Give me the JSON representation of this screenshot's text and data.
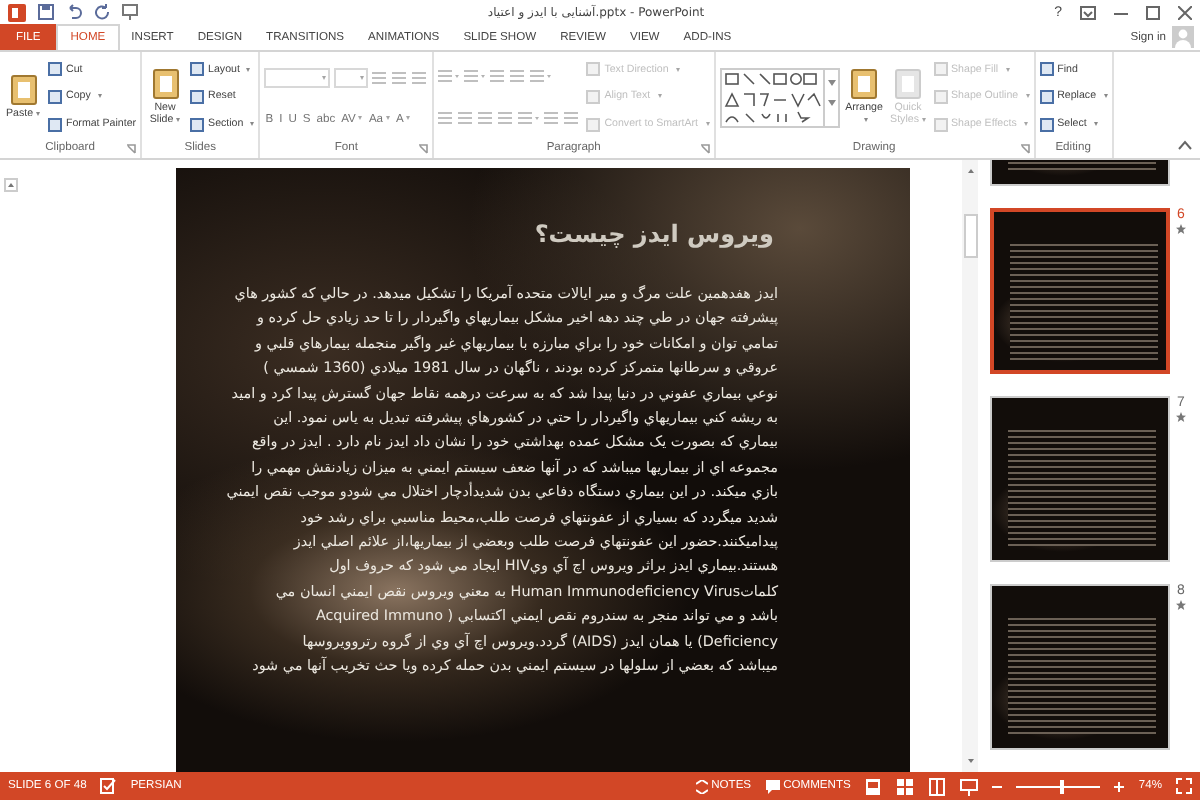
{
  "window": {
    "title": "آشنایی با ایدز و اعتیاد.pptx - PowerPoint",
    "help": "?",
    "sign_in": "Sign in"
  },
  "tabs": [
    {
      "label": "FILE",
      "kind": "file",
      "selected": false
    },
    {
      "label": "HOME",
      "kind": "tab",
      "selected": true
    },
    {
      "label": "INSERT",
      "kind": "tab",
      "selected": false
    },
    {
      "label": "DESIGN",
      "kind": "tab",
      "selected": false
    },
    {
      "label": "TRANSITIONS",
      "kind": "tab",
      "selected": false
    },
    {
      "label": "ANIMATIONS",
      "kind": "tab",
      "selected": false
    },
    {
      "label": "SLIDE SHOW",
      "kind": "tab",
      "selected": false
    },
    {
      "label": "REVIEW",
      "kind": "tab",
      "selected": false
    },
    {
      "label": "VIEW",
      "kind": "tab",
      "selected": false
    },
    {
      "label": "ADD-INS",
      "kind": "tab",
      "selected": false
    }
  ],
  "ribbon": {
    "groups": [
      {
        "label": "Clipboard",
        "launcher": true,
        "columns": [
          [
            [
              {
                "kind": "large",
                "label": "Paste",
                "dropdown": true,
                "disabled": false
              }
            ]
          ],
          [
            [
              {
                "kind": "small",
                "label": "Cut",
                "dropdown": false,
                "disabled": false
              }
            ],
            [
              {
                "kind": "small",
                "label": "Copy",
                "dropdown": true,
                "disabled": false
              }
            ],
            [
              {
                "kind": "small",
                "label": "Format Painter",
                "dropdown": false,
                "disabled": false
              }
            ]
          ]
        ]
      },
      {
        "label": "Slides",
        "launcher": false,
        "columns": [
          [
            [
              {
                "kind": "large",
                "label": "New Slide",
                "dropdown": true,
                "disabled": false
              }
            ]
          ],
          [
            [
              {
                "kind": "small",
                "label": "Layout",
                "dropdown": true,
                "disabled": false
              }
            ],
            [
              {
                "kind": "small",
                "label": "Reset",
                "dropdown": false,
                "disabled": false
              }
            ],
            [
              {
                "kind": "small",
                "label": "Section",
                "dropdown": true,
                "disabled": false
              }
            ]
          ]
        ]
      },
      {
        "label": "Font",
        "launcher": true,
        "columns": [
          [
            [
              {
                "kind": "field",
                "dropdown": true,
                "disabled": true
              },
              {
                "kind": "smallfield",
                "dropdown": true,
                "disabled": true
              },
              {
                "kind": "icon",
                "dropdown": false,
                "disabled": true
              },
              {
                "kind": "icon",
                "dropdown": false,
                "disabled": true
              },
              {
                "kind": "icon",
                "dropdown": false,
                "disabled": true
              }
            ],
            [
              {
                "kind": "glyph",
                "label": "B",
                "dropdown": false,
                "disabled": true
              },
              {
                "kind": "glyph",
                "label": "I",
                "dropdown": false,
                "disabled": true
              },
              {
                "kind": "glyph",
                "label": "U",
                "dropdown": false,
                "disabled": true
              },
              {
                "kind": "glyph",
                "label": "S",
                "dropdown": false,
                "disabled": true
              },
              {
                "kind": "glyph",
                "label": "abc",
                "dropdown": false,
                "disabled": true
              },
              {
                "kind": "glyph",
                "label": "AV",
                "dropdown": true,
                "disabled": true
              },
              {
                "kind": "glyph",
                "label": "Aa",
                "dropdown": true,
                "disabled": true
              },
              {
                "kind": "glyph",
                "label": "A",
                "dropdown": true,
                "disabled": true
              }
            ]
          ]
        ]
      },
      {
        "label": "Paragraph",
        "launcher": true,
        "columns": [
          [
            [
              {
                "kind": "icon",
                "dropdown": true,
                "disabled": true
              },
              {
                "kind": "icon",
                "dropdown": true,
                "disabled": true
              },
              {
                "kind": "icon",
                "dropdown": false,
                "disabled": true
              },
              {
                "kind": "icon",
                "dropdown": false,
                "disabled": true
              },
              {
                "kind": "icon",
                "dropdown": true,
                "disabled": true
              }
            ],
            [
              {
                "kind": "icon",
                "dropdown": false,
                "disabled": true
              },
              {
                "kind": "icon",
                "dropdown": false,
                "disabled": true
              },
              {
                "kind": "icon",
                "dropdown": false,
                "disabled": true
              },
              {
                "kind": "icon",
                "dropdown": false,
                "disabled": true
              },
              {
                "kind": "icon",
                "dropdown": true,
                "disabled": true
              },
              {
                "kind": "icon",
                "dropdown": false,
                "disabled": true
              },
              {
                "kind": "icon",
                "dropdown": false,
                "disabled": true
              }
            ]
          ],
          [
            [
              {
                "kind": "small",
                "label": "Text Direction",
                "dropdown": true,
                "disabled": true
              }
            ],
            [
              {
                "kind": "small",
                "label": "Align Text",
                "dropdown": true,
                "disabled": true
              }
            ],
            [
              {
                "kind": "small",
                "label": "Convert to SmartArt",
                "dropdown": true,
                "disabled": true
              }
            ]
          ]
        ]
      },
      {
        "label": "Drawing",
        "launcher": true,
        "columns": [
          [
            [
              {
                "kind": "gallery"
              }
            ]
          ],
          [
            [
              {
                "kind": "large",
                "label": "Arrange",
                "dropdown": true,
                "disabled": false
              }
            ]
          ],
          [
            [
              {
                "kind": "large",
                "label": "Quick Styles",
                "dropdown": true,
                "disabled": true
              }
            ]
          ],
          [
            [
              {
                "kind": "small",
                "label": "Shape Fill",
                "dropdown": true,
                "disabled": true
              }
            ],
            [
              {
                "kind": "small",
                "label": "Shape Outline",
                "dropdown": true,
                "disabled": true
              }
            ],
            [
              {
                "kind": "small",
                "label": "Shape Effects",
                "dropdown": true,
                "disabled": true
              }
            ]
          ]
        ]
      },
      {
        "label": "Editing",
        "launcher": false,
        "columns": [
          [
            [
              {
                "kind": "small",
                "label": "Find",
                "dropdown": false,
                "disabled": false
              }
            ],
            [
              {
                "kind": "small",
                "label": "Replace",
                "dropdown": true,
                "disabled": false
              }
            ],
            [
              {
                "kind": "small",
                "label": "Select",
                "dropdown": true,
                "disabled": false
              }
            ]
          ]
        ]
      }
    ]
  },
  "slide": {
    "title": "ویروس ایدز چیست؟",
    "lines": [
      "ایدز هفدهمین علت مرگ و میر ایالات متحده آمریکا را تشکیل میدهد. در حالي که کشور هاي",
      "پیشرفته جهان در طي چند دهه اخیر مشکل بیماریهاي واگیردار را تا حد زیادي حل کرده و",
      "تمامي توان و امکانات خود را براي مبارزه با بیماریهاي غیر واگیر منجمله بیمارهاي قلبي و",
      "عروقي و سرطانها متمرکز کرده بودند ، ناگهان در سال 1981 میلادي (1360 شمسي )",
      "نوعي بیماري عفوني در دنیا پیدا شد که به سرعت درهمه نقاط جهان گسترش پیدا کرد و امید",
      "به ریشه کني بیماریهاي واگیردار را حتي در کشورهاي پیشرفته تبدیل به یاس نمود. این",
      "بیماري که بصورت یک مشکل عمده بهداشتي خود را نشان داد ایدز نام دارد . ایدز در واقع",
      "مجموعه اي از بیماریها میباشد که در آنها ضعف سیستم ایمني به میزان زیادنقش مهمي را",
      "بازي میکند. در این بیماري دستگاه دفاعي بدن شدیدأدچار اختلال مي شودو موجب نقص ایمني",
      "شدید میگردد که بسیاري از عفونتهاي فرصت طلب،محیط مناسبي براي رشد خود",
      "پیدامیکنند.حضور این عفونتهاي فرصت طلب وبعضي از بیماریها،از علائم اصلي ایدز",
      "هستند.بیماري ایدز براثر ویروس اچ آي ويHIV ایجاد مي شود که حروف اول",
      "کلماتHuman Immunodeficiency Virus به معني ویروس نقص ایمني انسان مي",
      "باشد و مي تواند منجر به سندروم نقص ایمني اکتسابي ( Acquired Immuno",
      "Deficiency) یا همان ایدز (AIDS) گردد.ویروس اچ آي وي از گروه رتروویروسها",
      "میباشد که بعضي از سلولها در سیستم ایمني بدن حمله کرده ویا حث تخریب آنها مي شود"
    ]
  },
  "thumbnails": [
    {
      "selected": false,
      "animated": false
    },
    {
      "number": "6",
      "selected": true,
      "animated": true
    },
    {
      "number": "7",
      "selected": false,
      "animated": true
    },
    {
      "number": "8",
      "selected": false,
      "animated": true
    }
  ],
  "status_bar": {
    "slide": "SLIDE 6 OF 48",
    "language": "PERSIAN",
    "notes": "NOTES",
    "comments": "COMMENTS",
    "zoom": {
      "level": 0.55,
      "reading": "74%"
    }
  }
}
